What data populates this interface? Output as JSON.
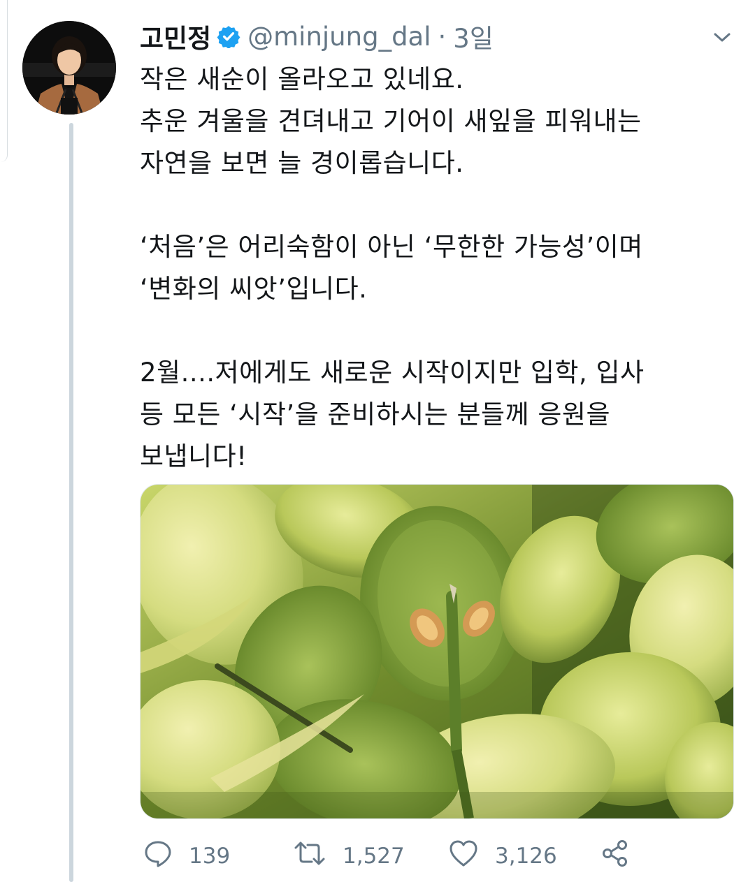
{
  "tweet": {
    "author_name": "고민정",
    "handle": "@minjung_dal",
    "separator": "·",
    "time": "3일",
    "verified": true,
    "lines": [
      "작은 새순이 올라오고 있네요.",
      "추운 겨울을 견뎌내고 기어이 새잎을 피워내는",
      "자연을 보면 늘 경이롭습니다.",
      "",
      "‘처음’은 어리숙함이 아닌 ‘무한한 가능성’이며",
      "‘변화의 씨앗’입니다.",
      "",
      "2월....저에게도 새로운 시작이지만 입학, 입사",
      "등 모든 ‘시작’을 준비하시는 분들께 응원을",
      "보냅니다!"
    ],
    "media_icon": "photo-green-leaves-and-buds"
  },
  "actions": {
    "reply_count": "139",
    "retweet_count": "1,527",
    "like_count": "3,126",
    "reply_icon": "reply-icon",
    "retweet_icon": "retweet-icon",
    "like_icon": "heart-icon",
    "share_icon": "share-icon"
  },
  "colors": {
    "text": "#14171a",
    "secondary": "#657786",
    "verified": "#1da1f2",
    "thread_line": "#ccd6dd"
  }
}
